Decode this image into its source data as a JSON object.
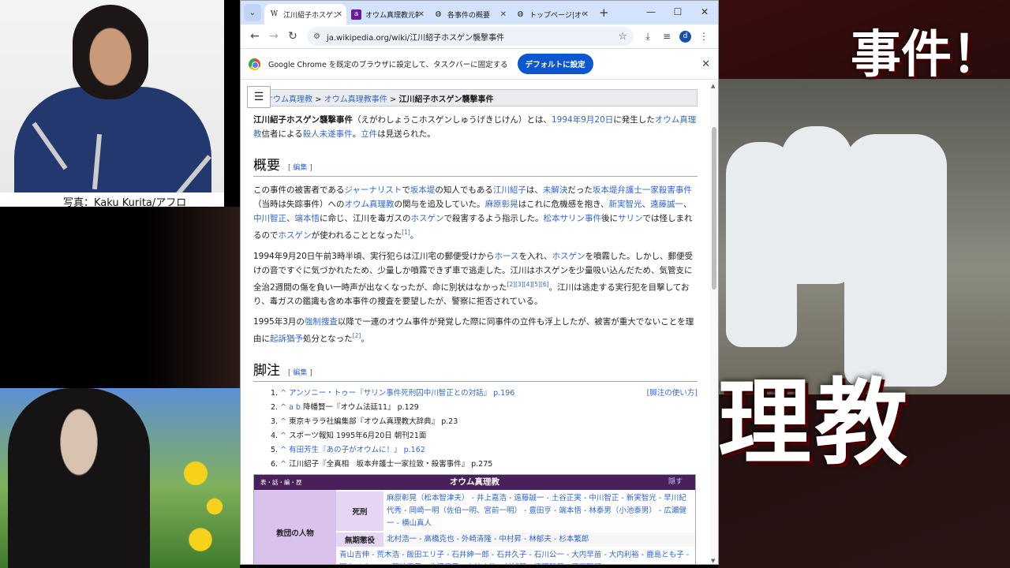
{
  "overlay": {
    "photo_credit": "写真：Kaku Kurita/アフロ",
    "title_top": "事件！",
    "title_bottom": "理教"
  },
  "browser": {
    "tabs": [
      {
        "icon": "W",
        "title": "江川紹子ホスゲン襲撃事件",
        "active": true
      },
      {
        "icon": "a",
        "title": "オウム真理教元幹部",
        "active": false
      },
      {
        "icon": "globe",
        "title": "各事件の概要",
        "active": false
      },
      {
        "icon": "globe",
        "title": "トップページ|オウム",
        "active": false
      }
    ],
    "url": "ja.wikipedia.org/wiki/江川紹子ホスゲン襲撃事件",
    "profile_initial": "d",
    "infobar_text": "Google Chrome を既定のブラウザに設定して、タスクバーに固定する",
    "default_button": "デフォルトに設定"
  },
  "article": {
    "breadcrumb": {
      "a": "オウム真理教",
      "sep": " > ",
      "b": "オウム真理教事件",
      "c": "江川紹子ホスゲン襲撃事件"
    },
    "intro": {
      "bold": "江川紹子ホスゲン襲撃事件",
      "t1": "（えがわしょうこホスゲンしゅうげきじけん）とは、",
      "l1": "1994年9月20日",
      "t2": "に発生した",
      "l2": "オウム真理教",
      "t3": "信者による",
      "l3": "殺人未遂事件",
      "t4": "。",
      "l4": "立件",
      "t5": "は見送られた。"
    },
    "section_overview": "概要",
    "edit": "編集",
    "p1": {
      "t1": "この事件の被害者である",
      "l1": "ジャーナリスト",
      "t2": "で",
      "l2": "坂本堤",
      "t3": "の知人でもある",
      "l3": "江川紹子",
      "t4": "は、",
      "l4": "未解決",
      "t5": "だった",
      "l5": "坂本堤弁護士一家殺害事件",
      "t6": "（当時は失踪事件）への",
      "l6": "オウム真理教",
      "t7": "の関与を追及していた。",
      "l7": "麻原彰晃",
      "t8": "はこれに危機感を抱き、",
      "l8": "新実智光",
      "t9": "、",
      "l9": "遠藤誠一",
      "t10": "、",
      "l10": "中川智正",
      "t11": "、",
      "l11": "端本悟",
      "t12": "に命じ、江川を毒ガスの",
      "l12": "ホスゲン",
      "t13": "で殺害するよう指示した。",
      "l13": "松本サリン事件",
      "t14": "後に",
      "l14": "サリン",
      "t15": "では怪しまれるので",
      "l15": "ホスゲン",
      "t16": "が使われることとなった",
      "ref": "[1]",
      "t17": "。"
    },
    "p2": {
      "t1": "1994年9月20日午前3時半頃、実行犯らは江川宅の郵便受けから",
      "l1": "ホース",
      "t2": "を入れ、",
      "l2": "ホスゲン",
      "t3": "を噴霧した。しかし、郵便受けの音ですぐに気づかれたため、少量しか噴霧できず車で逃走した。江川はホスゲンを少量吸い込んだため、気管支に全治2週間の傷を負い一時声が出なくなったが、命に別状はなかった",
      "refs": "[2][3][4][5][6]",
      "t4": "。江川は逃走する実行犯を目撃しており、毒ガスの鑑識も含め本事件の捜査を要望したが、警察に拒否されている。"
    },
    "p3": {
      "t1": "1995年3月の",
      "l1": "強制捜査",
      "t2": "以降で一連のオウム事件が発覚した際に同事件の立件も浮上したが、被害が重大でないことを理由に",
      "l2": "起訴猶予",
      "t3": "処分となった",
      "ref": "[2]",
      "t4": "。"
    },
    "section_notes": "脚注",
    "notes_usage": "[脚注の使い方]",
    "notes": [
      {
        "num": "1.",
        "caret": "^",
        "text": "アンソニー・トゥー『サリン事件死刑囚中川智正との対話』 p.196",
        "link": true
      },
      {
        "num": "2.",
        "caret": "^ a b",
        "text": "降幡賢一『オウム法廷11』 p.129",
        "link": false
      },
      {
        "num": "3.",
        "caret": "^",
        "text": "東京キララ社編集部『オウム真理教大辞典』 p.23",
        "link": false
      },
      {
        "num": "4.",
        "caret": "^",
        "text": "スポーツ報知 1995年6月20日 朝刊21面",
        "link": false
      },
      {
        "num": "5.",
        "caret": "^",
        "text": "有田芳生『あの子がオウムに！』 p.162",
        "link": true
      },
      {
        "num": "6.",
        "caret": "^",
        "text": "江川紹子『全真相　坂本弁護士一家拉致・殺害事件』 p.275",
        "link": false
      }
    ],
    "navbox": {
      "vde": "表・話・編・歴",
      "title": "オウム真理教",
      "hide": "隠す",
      "group": "教団の人物",
      "rows": [
        {
          "label": "死刑",
          "text": "麻原彰晃（松本智津夫） - 井上嘉浩 - 遠藤誠一 - 土谷正実 - 中川智正 - 新実智光 - 早川紀代秀 - 岡崎一明（佐伯一明、宮前一明） - 豊田亨 - 端本悟 - 林泰男（小池泰男） - 広瀬健一 - 横山真人"
        },
        {
          "label": "無期懲役",
          "text": "北村浩一 - 高橋克也 - 外崎清隆 - 中村昇 - 林郁夫 - 杉本繁郎"
        },
        {
          "label": "",
          "text": "青山吉伸 - 荒木浩 - 飯田エリ子 - 石井紳一郎 - 石井久子 - 石川公一 - 大内早苗 - 大内利裕 - 鹿島とも子 - 河上イチロー - 菊地直子 - 北沢優子 - 上祐史浩 - 杉浦茂 - 滝澤和義 - 田下聖明"
        }
      ]
    }
  }
}
